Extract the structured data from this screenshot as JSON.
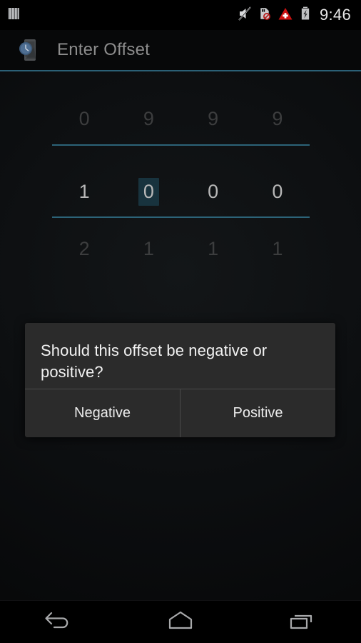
{
  "status_bar": {
    "notification_icon": "notification-bars-icon",
    "icons": [
      {
        "name": "ringer-muted-icon"
      },
      {
        "name": "sd-card-blocked-icon"
      },
      {
        "name": "warning-triangle-icon"
      },
      {
        "name": "battery-charging-icon"
      }
    ],
    "clock": "9:46"
  },
  "action_bar": {
    "app_icon": "clock-phone-app-icon",
    "title": "Enter Offset"
  },
  "number_picker": {
    "columns": 4,
    "previous_row": [
      "0",
      "9",
      "9",
      "9"
    ],
    "selected_row": [
      "1",
      "0",
      "0",
      "0"
    ],
    "next_row": [
      "2",
      "1",
      "1",
      "1"
    ],
    "focused_column_index": 1,
    "value": "1000",
    "divider_color": "#2c6378",
    "selection_highlight_color": "#18333e"
  },
  "dialog": {
    "message": "Should this offset be negative or positive?",
    "buttons": [
      {
        "label": "Negative",
        "name": "negative"
      },
      {
        "label": "Positive",
        "name": "positive"
      }
    ]
  },
  "navigation_bar": {
    "buttons": [
      {
        "name": "back-icon"
      },
      {
        "name": "home-icon"
      },
      {
        "name": "recents-icon"
      }
    ]
  },
  "colors": {
    "accent": "#2c6378",
    "background": "#0c0e0f",
    "dialog_background": "#2b2b2b",
    "warning_red": "#cc1111"
  }
}
